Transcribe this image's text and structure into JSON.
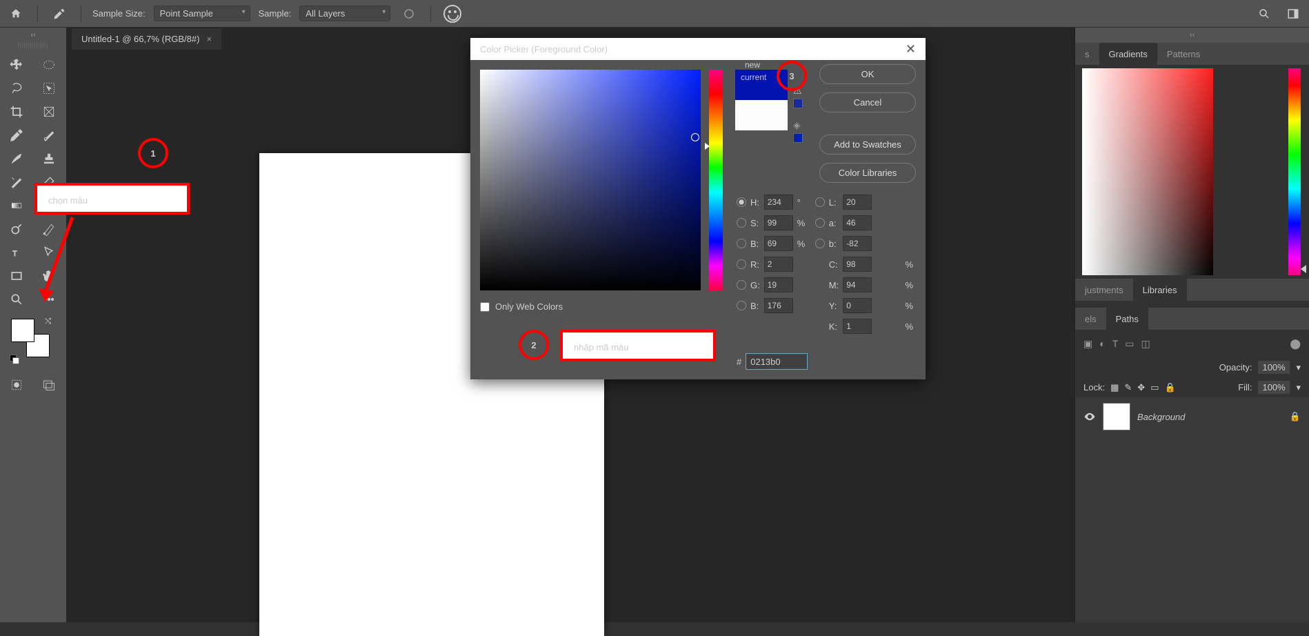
{
  "topbar": {
    "sample_size_label": "Sample Size:",
    "sample_size_value": "Point Sample",
    "sample_label": "Sample:",
    "sample_value": "All Layers"
  },
  "doc_tab": {
    "title": "Untitled-1 @ 66,7% (RGB/8#)"
  },
  "dialog": {
    "title": "Color Picker (Foreground Color)",
    "new_label": "new",
    "current_label": "current",
    "ok": "OK",
    "cancel": "Cancel",
    "add_swatches": "Add to Swatches",
    "libraries": "Color Libraries",
    "only_web": "Only Web Colors",
    "H": "234",
    "S": "99",
    "B": "69",
    "L": "20",
    "a": "46",
    "b2": "-82",
    "R": "2",
    "G": "19",
    "Bv": "176",
    "C": "98",
    "M": "94",
    "Y": "0",
    "K": "1",
    "hex": "0213b0",
    "labels": {
      "H": "H:",
      "S": "S:",
      "B": "B:",
      "L": "L:",
      "a": "a:",
      "b": "b:",
      "R": "R:",
      "G": "G:",
      "Bv": "B:",
      "C": "C:",
      "M": "M:",
      "Y": "Y:",
      "K": "K:",
      "deg": "°",
      "pct": "%",
      "hash": "#"
    }
  },
  "right_panels": {
    "tabs1": [
      "s",
      "Gradients",
      "Patterns"
    ],
    "tabs2": [
      "justments",
      "Libraries"
    ],
    "tabs3": [
      "els",
      "Paths"
    ],
    "opacity_label": "Opacity:",
    "opacity_val": "100%",
    "lock_label": "Lock:",
    "fill_label": "Fill:",
    "fill_val": "100%",
    "layer_name": "Background"
  },
  "annotations": {
    "n1": "1",
    "n2": "2",
    "n3": "3",
    "t1": "chọn màu",
    "t2": "nhập mã màu"
  }
}
